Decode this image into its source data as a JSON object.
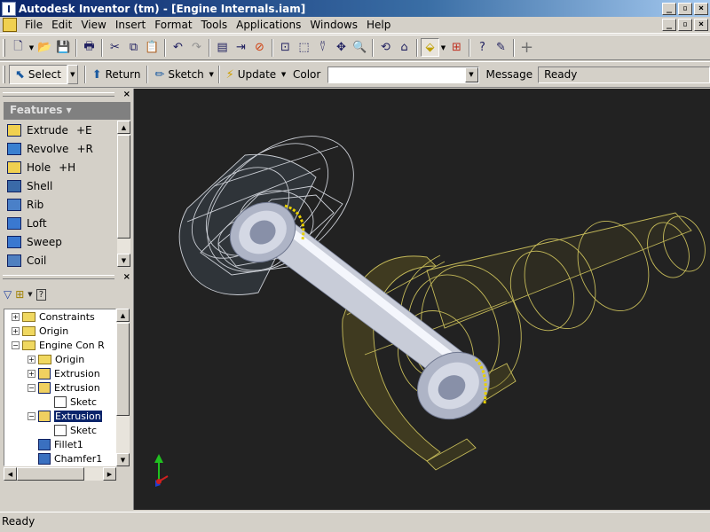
{
  "window": {
    "title": "Autodesk Inventor (tm) - [Engine Internals.iam]",
    "app_icon": "inventor-icon",
    "controls": {
      "minimize": "_",
      "restore": "▫",
      "close": "×"
    }
  },
  "menu": {
    "items": [
      "File",
      "Edit",
      "View",
      "Insert",
      "Format",
      "Tools",
      "Applications",
      "Windows",
      "Help"
    ],
    "doc_controls": {
      "minimize": "_",
      "restore": "▫",
      "close": "×"
    }
  },
  "toolbar_row2": {
    "select_label": "Select",
    "return_label": "Return",
    "sketch_label": "Sketch",
    "update_label": "Update",
    "color_label": "Color",
    "color_value": "",
    "message_label": "Message",
    "message_value": "Ready"
  },
  "features_panel": {
    "header": "Features ▾",
    "items": [
      {
        "label": "Extrude",
        "shortcut": "+E",
        "icon": "extrude-icon"
      },
      {
        "label": "Revolve",
        "shortcut": "+R",
        "icon": "revolve-icon"
      },
      {
        "label": "Hole",
        "shortcut": "+H",
        "icon": "hole-icon"
      },
      {
        "label": "Shell",
        "shortcut": "",
        "icon": "shell-icon"
      },
      {
        "label": "Rib",
        "shortcut": "",
        "icon": "rib-icon"
      },
      {
        "label": "Loft",
        "shortcut": "",
        "icon": "loft-icon"
      },
      {
        "label": "Sweep",
        "shortcut": "",
        "icon": "sweep-icon"
      },
      {
        "label": "Coil",
        "shortcut": "",
        "icon": "coil-icon"
      }
    ]
  },
  "browser": {
    "items": [
      {
        "label": "Constraints",
        "indent": 1,
        "exp": "+",
        "icon": "folder"
      },
      {
        "label": "Origin",
        "indent": 1,
        "exp": "+",
        "icon": "folder"
      },
      {
        "label": "Engine Con R",
        "indent": 1,
        "exp": "−",
        "icon": "folder"
      },
      {
        "label": "Origin",
        "indent": 2,
        "exp": "+",
        "icon": "folder"
      },
      {
        "label": "Extrusion",
        "indent": 2,
        "exp": "+",
        "icon": "part"
      },
      {
        "label": "Extrusion",
        "indent": 2,
        "exp": "−",
        "icon": "part"
      },
      {
        "label": "Sketc",
        "indent": 3,
        "exp": "",
        "icon": "sketch"
      },
      {
        "label": "Extrusion",
        "indent": 2,
        "exp": "−",
        "icon": "part",
        "selected": true
      },
      {
        "label": "Sketc",
        "indent": 3,
        "exp": "",
        "icon": "sketch"
      },
      {
        "label": "Fillet1",
        "indent": 2,
        "exp": "",
        "icon": "fillet"
      },
      {
        "label": "Chamfer1",
        "indent": 2,
        "exp": "",
        "icon": "fillet"
      }
    ]
  },
  "status": {
    "text": "Ready"
  },
  "colors": {
    "viewport_bg": "#222222",
    "rod_color": "#c8ccd8",
    "wire_yellow": "#d8cc60",
    "wire_white": "#e8ecf4"
  }
}
